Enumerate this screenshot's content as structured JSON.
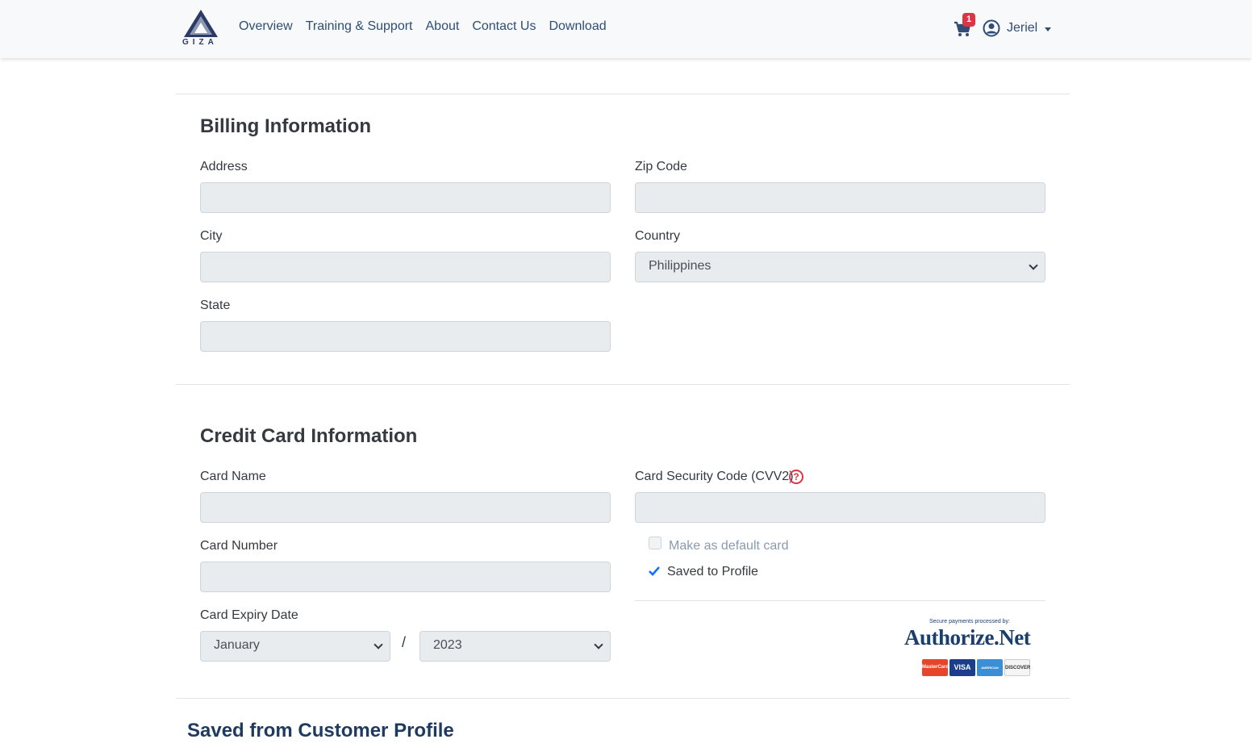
{
  "navbar": {
    "logo_text": "GIZA",
    "links": [
      "Overview",
      "Training & Support",
      "About",
      "Contact Us",
      "Download"
    ],
    "cart_count": "1",
    "user_name": "Jeriel"
  },
  "billing": {
    "title": "Billing Information",
    "address_label": "Address",
    "zip_label": "Zip Code",
    "city_label": "City",
    "country_label": "Country",
    "country_value": "Philippines",
    "state_label": "State"
  },
  "credit_card": {
    "title": "Credit Card Information",
    "card_name_label": "Card Name",
    "cvv_label": "Card Security Code (CVV2)",
    "help_glyph": "?",
    "card_number_label": "Card Number",
    "default_card_label": "Make as default card",
    "saved_label": "Saved to Profile",
    "expiry_label": "Card Expiry Date",
    "expiry_month": "January",
    "expiry_separator": "/",
    "expiry_year": "2023"
  },
  "authorize_net": {
    "tagline": "Secure payments processed by:",
    "name": "Authorize.Net",
    "card_logos": [
      "MasterCard",
      "VISA",
      "AMERICAN EXPRESS",
      "DISCOVER"
    ]
  },
  "profile": {
    "title": "Saved from Customer Profile"
  },
  "colors": {
    "navbar_bg": "#f8f9fa",
    "nav_link": "#2f4d75",
    "badge": "#dc3545",
    "input_bg": "#e9ecef",
    "check_blue": "#0d6efd"
  }
}
